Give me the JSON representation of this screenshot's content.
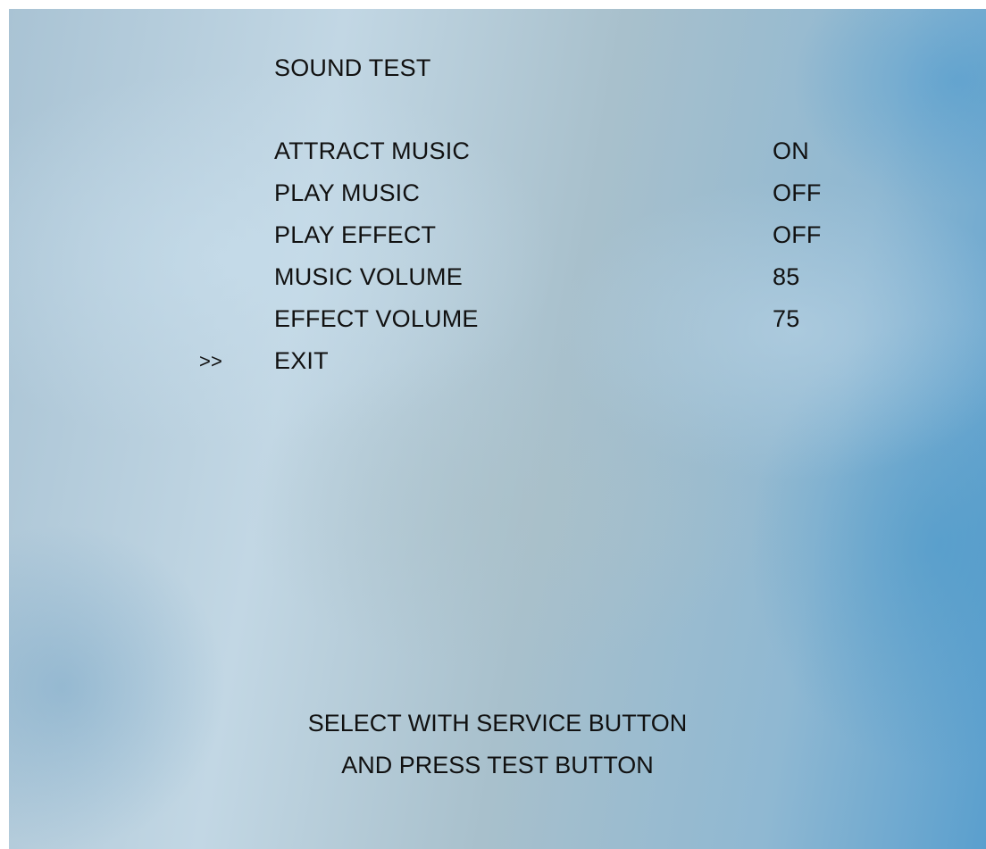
{
  "screen": {
    "title": "SOUND TEST",
    "cursor": ">>",
    "items": [
      {
        "label": "ATTRACT MUSIC",
        "value": "ON"
      },
      {
        "label": "PLAY MUSIC",
        "value": "OFF"
      },
      {
        "label": "PLAY EFFECT",
        "value": "OFF"
      },
      {
        "label": "MUSIC VOLUME",
        "value": "85"
      },
      {
        "label": "EFFECT VOLUME",
        "value": "75"
      },
      {
        "label": "EXIT",
        "value": ""
      }
    ],
    "selected_index": 5,
    "instructions": [
      "SELECT WITH SERVICE BUTTON",
      "AND PRESS TEST BUTTON"
    ]
  }
}
